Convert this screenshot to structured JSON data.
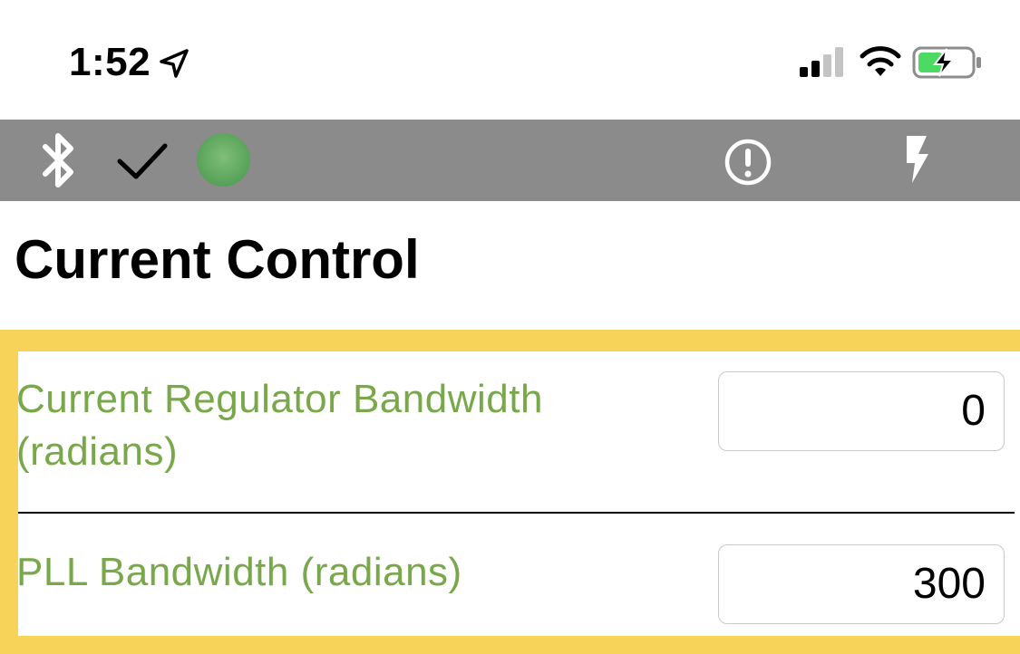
{
  "status_bar": {
    "time": "1:52",
    "icons": [
      "location-arrow-icon",
      "signal-icon",
      "wifi-icon",
      "battery-charging-icon"
    ]
  },
  "toolbar": {
    "icons": [
      "bluetooth-icon",
      "checkmark-icon",
      "status-indicator",
      "alert-icon",
      "flash-icon"
    ],
    "background_color": "#8b8b8b",
    "status_indicator_color": "#5aa35a"
  },
  "page": {
    "title": "Current Control"
  },
  "settings": {
    "accent_color": "#f7d35a",
    "label_color": "#79a84a",
    "rows": [
      {
        "label": "Current Regulator Bandwidth (radians)",
        "value": "0"
      },
      {
        "label": "PLL Bandwidth (radians)",
        "value": "300"
      }
    ]
  }
}
